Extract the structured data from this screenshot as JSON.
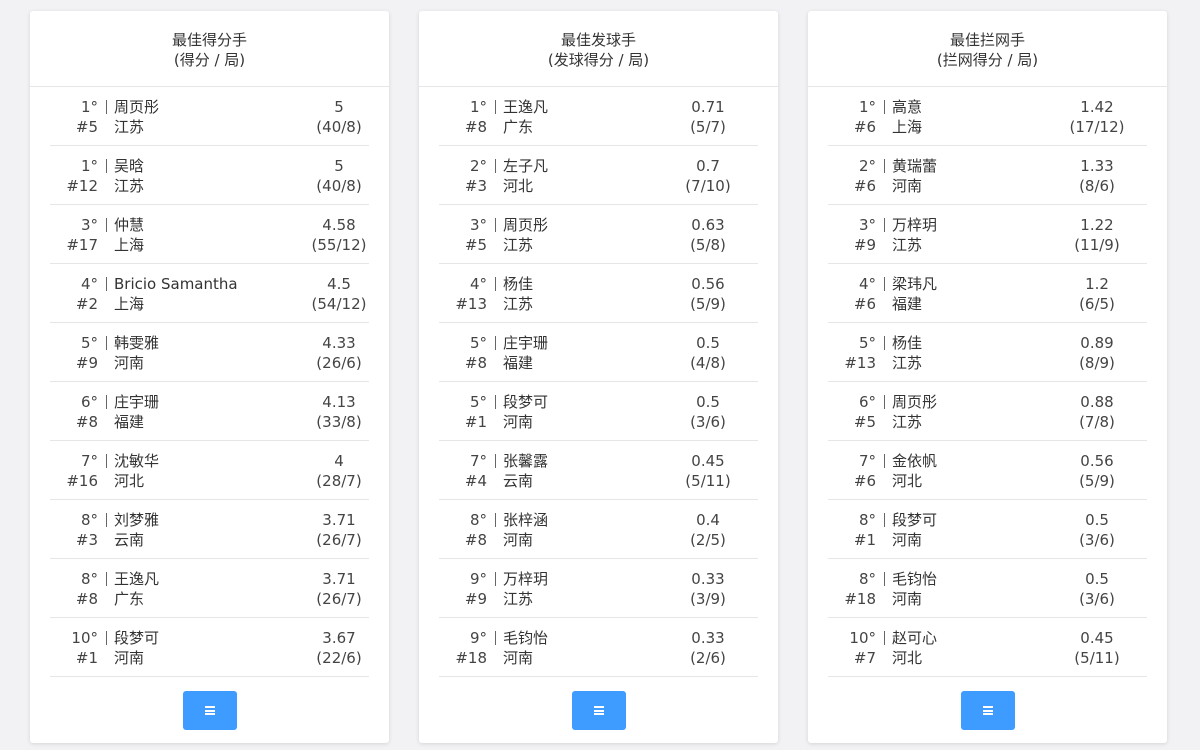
{
  "panels": [
    {
      "title": "最佳得分手",
      "subtitle": "(得分 / 局)",
      "rows": [
        {
          "rank": "1°",
          "number": "#5",
          "name": "周页彤",
          "team": "江苏",
          "value": "5",
          "detail": "(40/8)"
        },
        {
          "rank": "1°",
          "number": "#12",
          "name": "吴晗",
          "team": "江苏",
          "value": "5",
          "detail": "(40/8)"
        },
        {
          "rank": "3°",
          "number": "#17",
          "name": "仲慧",
          "team": "上海",
          "value": "4.58",
          "detail": "(55/12)"
        },
        {
          "rank": "4°",
          "number": "#2",
          "name": "Bricio Samantha",
          "team": "上海",
          "value": "4.5",
          "detail": "(54/12)"
        },
        {
          "rank": "5°",
          "number": "#9",
          "name": "韩雯雅",
          "team": "河南",
          "value": "4.33",
          "detail": "(26/6)"
        },
        {
          "rank": "6°",
          "number": "#8",
          "name": "庄宇珊",
          "team": "福建",
          "value": "4.13",
          "detail": "(33/8)"
        },
        {
          "rank": "7°",
          "number": "#16",
          "name": "沈敏华",
          "team": "河北",
          "value": "4",
          "detail": "(28/7)"
        },
        {
          "rank": "8°",
          "number": "#3",
          "name": "刘梦雅",
          "team": "云南",
          "value": "3.71",
          "detail": "(26/7)"
        },
        {
          "rank": "8°",
          "number": "#8",
          "name": "王逸凡",
          "team": "广东",
          "value": "3.71",
          "detail": "(26/7)"
        },
        {
          "rank": "10°",
          "number": "#1",
          "name": "段梦可",
          "team": "河南",
          "value": "3.67",
          "detail": "(22/6)"
        }
      ]
    },
    {
      "title": "最佳发球手",
      "subtitle": "(发球得分 / 局)",
      "rows": [
        {
          "rank": "1°",
          "number": "#8",
          "name": "王逸凡",
          "team": "广东",
          "value": "0.71",
          "detail": "(5/7)"
        },
        {
          "rank": "2°",
          "number": "#3",
          "name": "左子凡",
          "team": "河北",
          "value": "0.7",
          "detail": "(7/10)"
        },
        {
          "rank": "3°",
          "number": "#5",
          "name": "周页彤",
          "team": "江苏",
          "value": "0.63",
          "detail": "(5/8)"
        },
        {
          "rank": "4°",
          "number": "#13",
          "name": "杨佳",
          "team": "江苏",
          "value": "0.56",
          "detail": "(5/9)"
        },
        {
          "rank": "5°",
          "number": "#8",
          "name": "庄宇珊",
          "team": "福建",
          "value": "0.5",
          "detail": "(4/8)"
        },
        {
          "rank": "5°",
          "number": "#1",
          "name": "段梦可",
          "team": "河南",
          "value": "0.5",
          "detail": "(3/6)"
        },
        {
          "rank": "7°",
          "number": "#4",
          "name": "张馨露",
          "team": "云南",
          "value": "0.45",
          "detail": "(5/11)"
        },
        {
          "rank": "8°",
          "number": "#8",
          "name": "张梓涵",
          "team": "河南",
          "value": "0.4",
          "detail": "(2/5)"
        },
        {
          "rank": "9°",
          "number": "#9",
          "name": "万梓玥",
          "team": "江苏",
          "value": "0.33",
          "detail": "(3/9)"
        },
        {
          "rank": "9°",
          "number": "#18",
          "name": "毛钧怡",
          "team": "河南",
          "value": "0.33",
          "detail": "(2/6)"
        }
      ]
    },
    {
      "title": "最佳拦网手",
      "subtitle": "(拦网得分 / 局)",
      "rows": [
        {
          "rank": "1°",
          "number": "#6",
          "name": "高意",
          "team": "上海",
          "value": "1.42",
          "detail": "(17/12)"
        },
        {
          "rank": "2°",
          "number": "#6",
          "name": "黄瑞蕾",
          "team": "河南",
          "value": "1.33",
          "detail": "(8/6)"
        },
        {
          "rank": "3°",
          "number": "#9",
          "name": "万梓玥",
          "team": "江苏",
          "value": "1.22",
          "detail": "(11/9)"
        },
        {
          "rank": "4°",
          "number": "#6",
          "name": "梁玮凡",
          "team": "福建",
          "value": "1.2",
          "detail": "(6/5)"
        },
        {
          "rank": "5°",
          "number": "#13",
          "name": "杨佳",
          "team": "江苏",
          "value": "0.89",
          "detail": "(8/9)"
        },
        {
          "rank": "6°",
          "number": "#5",
          "name": "周页彤",
          "team": "江苏",
          "value": "0.88",
          "detail": "(7/8)"
        },
        {
          "rank": "7°",
          "number": "#6",
          "name": "金依帆",
          "team": "河北",
          "value": "0.56",
          "detail": "(5/9)"
        },
        {
          "rank": "8°",
          "number": "#1",
          "name": "段梦可",
          "team": "河南",
          "value": "0.5",
          "detail": "(3/6)"
        },
        {
          "rank": "8°",
          "number": "#18",
          "name": "毛钧怡",
          "team": "河南",
          "value": "0.5",
          "detail": "(3/6)"
        },
        {
          "rank": "10°",
          "number": "#7",
          "name": "赵可心",
          "team": "河北",
          "value": "0.45",
          "detail": "(5/11)"
        }
      ]
    }
  ],
  "more_button": {
    "icon": "list-icon",
    "color": "#3e9bff"
  }
}
